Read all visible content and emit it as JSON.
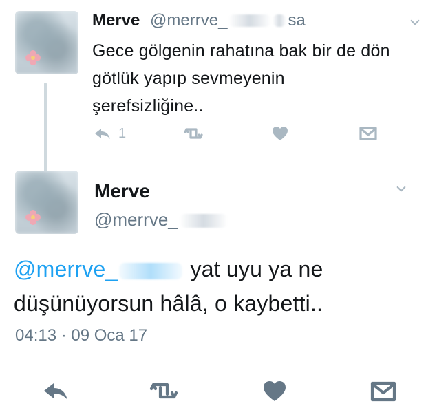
{
  "tweets": {
    "reply_parent": {
      "name": "Merve",
      "handle_prefix": "@merrve_",
      "handle_suffix": "sa",
      "text": "Gece gölgenin rahatına bak bir de dön\ngötlük yapıp sevmeyenin\nşerefsizliğine..",
      "reply_count": "1",
      "actions": {
        "reply_icon": "reply-icon",
        "retweet_icon": "retweet-icon",
        "like_icon": "heart-icon",
        "dm_icon": "message-icon"
      }
    },
    "main": {
      "name": "Merve",
      "handle_prefix": "@merrve_",
      "mention_prefix": "@merrve_",
      "text_after_mention": " yat uyu ya ne düşünüyorsun hâlâ, o kaybetti..",
      "timestamp": "04:13 · 09 Oca 17",
      "actions": {
        "reply_icon": "reply-icon",
        "retweet_icon": "retweet-icon",
        "like_icon": "heart-icon",
        "dm_icon": "message-icon"
      }
    }
  },
  "colors": {
    "text": "#14171a",
    "muted": "#657786",
    "icon_light": "#aab8c2",
    "icon_dark": "#657786",
    "link": "#1da1f2",
    "divider": "#e1e8ed",
    "thread_line": "#cfd9de"
  }
}
